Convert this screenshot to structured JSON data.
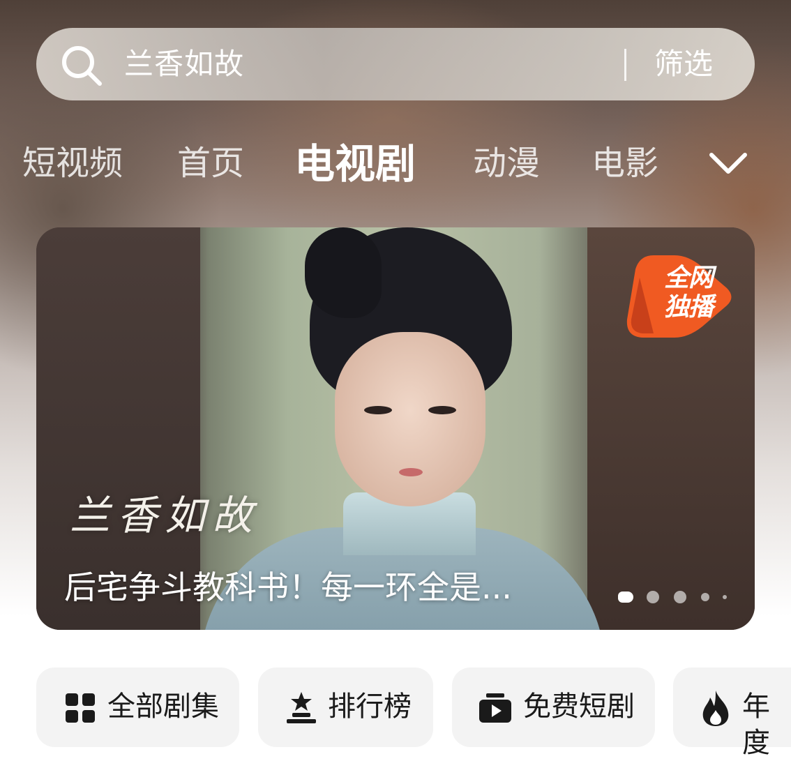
{
  "search": {
    "query": "兰香如故",
    "filter_label": "筛选"
  },
  "tabs": [
    {
      "label": "短视频",
      "active": false
    },
    {
      "label": "首页",
      "active": false
    },
    {
      "label": "电视剧",
      "active": true
    },
    {
      "label": "动漫",
      "active": false
    },
    {
      "label": "电影",
      "active": false
    }
  ],
  "banner": {
    "badge_line1": "全网",
    "badge_line2": "独播",
    "title_calligraphy": "兰香如故",
    "caption": "后宅争斗教科书！每一环全是...",
    "slide_count": 5,
    "active_slide": 1
  },
  "shortcuts": [
    {
      "label": "全部剧集",
      "icon": "grid-icon"
    },
    {
      "label": "排行榜",
      "icon": "podium-star-icon"
    },
    {
      "label": "免费短剧",
      "icon": "play-folder-icon"
    },
    {
      "label": "年度",
      "icon": "fire-icon"
    }
  ],
  "colors": {
    "badge_orange": "#f05a22",
    "chip_bg": "#f3f3f3",
    "text_dark": "#1a1a1a"
  }
}
